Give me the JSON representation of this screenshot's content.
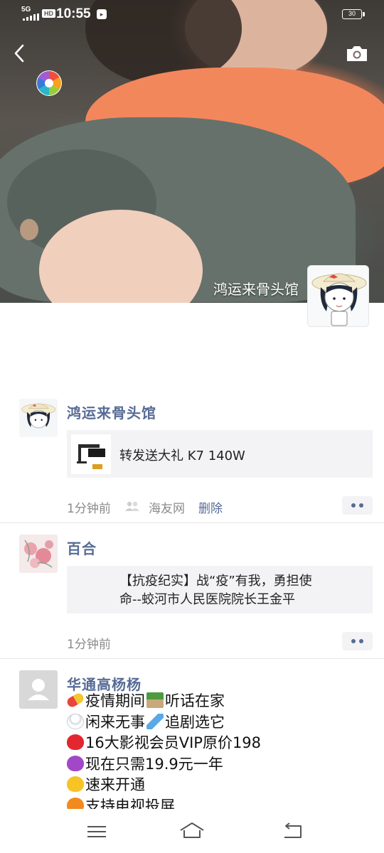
{
  "status_bar": {
    "network": "5G",
    "hd": "HD",
    "time": "10:55",
    "battery": "30"
  },
  "header": {
    "back_icon": "chevron-left-icon",
    "camera_icon": "camera-icon",
    "profile_name": "鸿运来骨头馆"
  },
  "feed": [
    {
      "author": "鸿运来骨头馆",
      "shared_title": "转发送大礼 K7 140W",
      "time": "1分钟前",
      "source": "海友网",
      "delete_label": "删除"
    },
    {
      "author": "百合",
      "shared_title_lines": [
        "【抗疫纪实】战“疫”有我，勇担使",
        "命--蛟河市人民医院院长王金平"
      ],
      "time": "1分钟前"
    },
    {
      "author": "华通高杨杨",
      "lines": [
        {
          "emoji": "pill-emoji",
          "text": "疫情期间"
        },
        {
          "emoji": "house-emoji",
          "text": "听话在家"
        },
        {
          "emoji": "snowman-emoji",
          "text": "闲来无事"
        },
        {
          "emoji": "airplane-emoji",
          "text": "追剧选它"
        },
        {
          "emoji": "red-heart-emoji",
          "text": "16大影视会员VIP原价198"
        },
        {
          "emoji": "purple-heart-emoji",
          "text": "现在只需19.9元一年"
        },
        {
          "emoji": "yellow-heart-emoji",
          "text": "速来开通"
        },
        {
          "emoji": "orange-heart-emoji",
          "text": "支持电视投屏"
        }
      ]
    }
  ],
  "colors": {
    "link_blue": "#576b95",
    "meta_gray": "#8a8a8a",
    "card_bg": "#f3f3f5"
  }
}
